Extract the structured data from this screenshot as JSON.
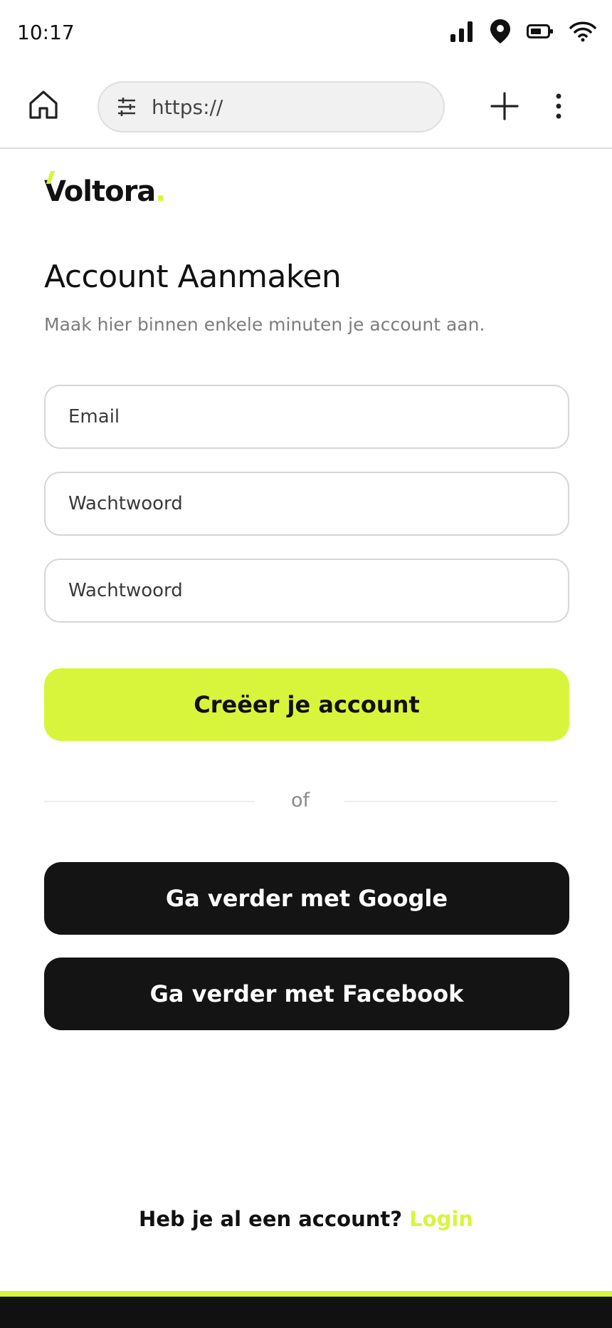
{
  "status_bar": {
    "time": "10:17",
    "icons": [
      "signal-icon",
      "location-icon",
      "battery-icon",
      "wifi-icon"
    ]
  },
  "browser": {
    "url": "https://",
    "icons": [
      "home-icon",
      "tune-icon",
      "plus-icon",
      "more-vert-icon"
    ]
  },
  "page": {
    "logo": "Voltora",
    "logo_dot": ".",
    "title": "Account Aanmaken",
    "subtitle": "Maak hier binnen enkele minuten je account aan.",
    "fields": {
      "email_placeholder": "Email",
      "password_placeholder": "Wachtwoord",
      "password_confirm_placeholder": "Wachtwoord"
    },
    "create_button": "Creëer je account",
    "divider": "of",
    "google_button": "Ga verder met Google",
    "facebook_button": "Ga verder met Facebook",
    "login_prompt": "Heb je al een account?",
    "login_link": "Login"
  },
  "colors": {
    "accent": "#d8f53c",
    "dark": "#141414",
    "text": "#111111",
    "muted": "#7c7c7c",
    "border": "#d6d6d6"
  }
}
